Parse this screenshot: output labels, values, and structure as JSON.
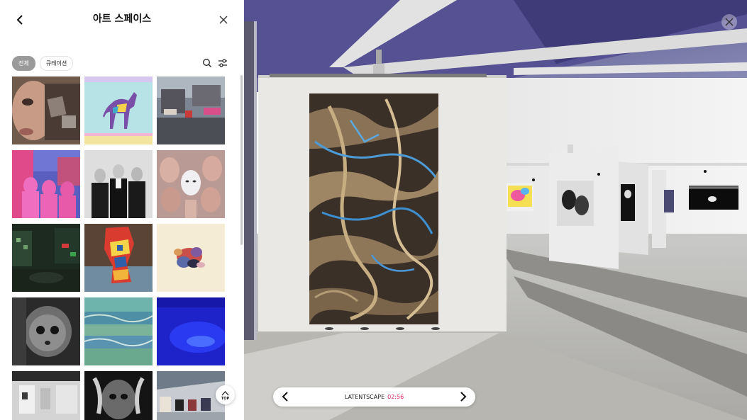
{
  "panel": {
    "title": "아트 스페이스",
    "back_icon": "chevron-left-icon",
    "close_icon": "close-icon",
    "filters": [
      {
        "label": "전체",
        "active": true
      },
      {
        "label": "큐레이션",
        "active": false
      }
    ],
    "search_icon": "search-icon",
    "filter_icon": "sliders-icon",
    "top_button": {
      "label": "TOP",
      "icon": "chevron-up-icon"
    },
    "artworks": [
      {
        "id": "cyborg-portrait"
      },
      {
        "id": "pastel-greyhound"
      },
      {
        "id": "virtual-plaza"
      },
      {
        "id": "pink-figures"
      },
      {
        "id": "bw-group-portrait"
      },
      {
        "id": "masked-heads"
      },
      {
        "id": "dark-3d-street"
      },
      {
        "id": "patterned-figure"
      },
      {
        "id": "floral-abstract"
      },
      {
        "id": "bw-doll"
      },
      {
        "id": "blue-green-texture"
      },
      {
        "id": "blue-glow"
      },
      {
        "id": "gallery-corridor"
      },
      {
        "id": "bw-hands-face"
      },
      {
        "id": "exhibition-room"
      }
    ]
  },
  "viewer": {
    "close_icon": "close-icon",
    "artwork_title": "LATENTSCAPE",
    "time": "02:56",
    "prev_icon": "chevron-left-icon",
    "next_icon": "chevron-right-icon",
    "time_color": "#e0245e"
  }
}
